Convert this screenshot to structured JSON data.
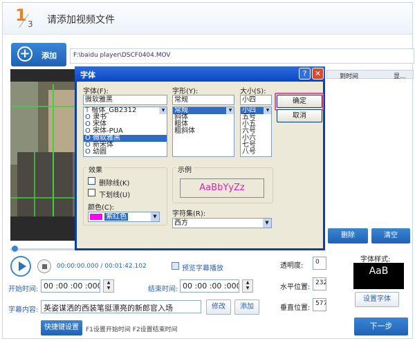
{
  "header": {
    "step_current": "1",
    "step_total": "3",
    "title": "请添加视频文件"
  },
  "add_button": {
    "label": "添加"
  },
  "file_path": "F:\\baidu player\\DSCF0404.MOV",
  "subtitle_list": {
    "columns": [
      "到时间",
      "显..."
    ]
  },
  "player": {
    "time": "00:00:00.000 / 00:01:42.102"
  },
  "preview_subtitle": {
    "label": "预览字幕播放"
  },
  "timing": {
    "start_label": "开始时间:",
    "start_value": "00 :00 :00 :000",
    "end_label": "结束时间:",
    "end_value": "00 :00 :00 :000"
  },
  "content": {
    "label": "字幕内容:",
    "value": "英姿谋洒的西装笔挺漂亮的新郎官入场"
  },
  "buttons": {
    "modify": "修改",
    "add": "添加",
    "shortcut": "快捷键设置",
    "delete": "删除",
    "clear": "清空",
    "set_font": "设置字体",
    "next": "下一步"
  },
  "shortcut_hint": "F1设置开始时间  F2设置结束时间",
  "position": {
    "transparency_label": "透明度:",
    "transparency_value": "0",
    "hpos_label": "水平位置:",
    "hpos_value": "232",
    "vpos_label": "垂直位置:",
    "vpos_value": "577"
  },
  "font_style": {
    "label": "字体样式:",
    "preview": "AaB"
  },
  "font_dialog": {
    "title": "字体",
    "font_label": "字体(F):",
    "font_value": "微软雅黑",
    "fonts": [
      "楷体_GB2312",
      "隶书",
      "宋体",
      "宋体-PUA",
      "微软雅黑",
      "新宋体",
      "幼圆"
    ],
    "fonts_selected": 4,
    "style_label": "字形(Y):",
    "style_value": "常规",
    "styles": [
      "常规",
      "斜体",
      "粗体",
      "粗斜体"
    ],
    "size_label": "大小(S):",
    "size_value": "小四",
    "sizes": [
      "小四",
      "五号",
      "小五",
      "六号",
      "小六",
      "七号",
      "八号"
    ],
    "ok": "确定",
    "cancel": "取消",
    "effects_label": "效果",
    "strike_label": "删除线(K)",
    "underline_label": "下划线(U)",
    "color_label": "颜色(C):",
    "color_value": "紫红色",
    "color_hex": "#ff00ff",
    "sample_label": "示例",
    "sample_text": "AaBbYyZz",
    "charset_label": "字符集(R):",
    "charset_value": "西方"
  },
  "colors": {
    "accent": "#2a63b4",
    "highlight": "#ea4da0"
  }
}
